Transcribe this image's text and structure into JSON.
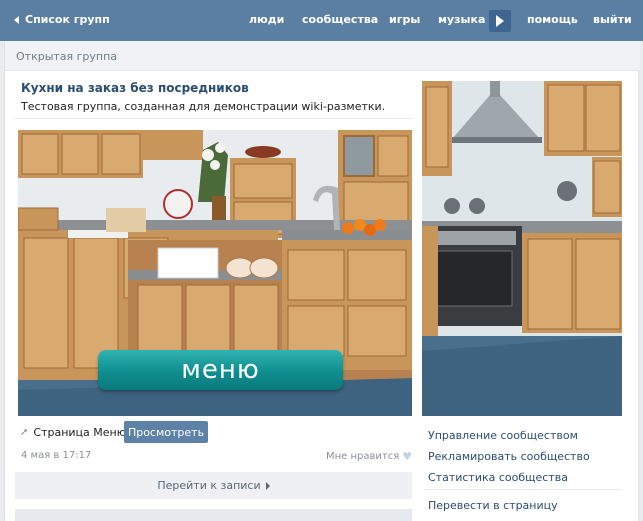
{
  "topbar": {
    "back_label": "Список групп",
    "nav": [
      "люди",
      "сообщества",
      "игры",
      "музыка",
      "помощь",
      "выйти"
    ]
  },
  "group": {
    "type_label": "Открытая группа",
    "title": "Кухни на заказ без посредников",
    "description": "Тестовая группа, созданная для демонстрации wiki-разметки."
  },
  "wall_post": {
    "menu_button_label": "меню",
    "page_link_label": "Страница Меню",
    "view_button_label": "Просмотреть",
    "date": "4 мая в 17:17",
    "like_label": "Мне нравится",
    "goto_posts_label": "Перейти к записи"
  },
  "sidebar": {
    "links": [
      "Управление сообществом",
      "Рекламировать сообщество",
      "Статистика сообщества",
      "Перевести в страницу"
    ]
  },
  "colors": {
    "header_bg": "#5b7ea3",
    "link": "#2b4c73",
    "menu_button": "#0f8e8f"
  }
}
